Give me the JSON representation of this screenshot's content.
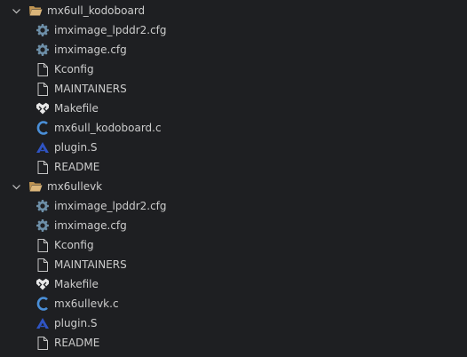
{
  "explorer": {
    "folders": [
      {
        "name": "mx6ull_kodoboard",
        "files": [
          {
            "name": "imximage_lpddr2.cfg",
            "icon": "gear-icon"
          },
          {
            "name": "imximage.cfg",
            "icon": "gear-icon"
          },
          {
            "name": "Kconfig",
            "icon": "file-icon"
          },
          {
            "name": "MAINTAINERS",
            "icon": "file-icon"
          },
          {
            "name": "Makefile",
            "icon": "makefile-icon"
          },
          {
            "name": "mx6ull_kodoboard.c",
            "icon": "c-file-icon"
          },
          {
            "name": "plugin.S",
            "icon": "assembly-icon"
          },
          {
            "name": "README",
            "icon": "file-icon"
          }
        ]
      },
      {
        "name": "mx6ullevk",
        "files": [
          {
            "name": "imximage_lpddr2.cfg",
            "icon": "gear-icon"
          },
          {
            "name": "imximage.cfg",
            "icon": "gear-icon"
          },
          {
            "name": "Kconfig",
            "icon": "file-icon"
          },
          {
            "name": "MAINTAINERS",
            "icon": "file-icon"
          },
          {
            "name": "Makefile",
            "icon": "makefile-icon"
          },
          {
            "name": "mx6ullevk.c",
            "icon": "c-file-icon"
          },
          {
            "name": "plugin.S",
            "icon": "assembly-icon"
          },
          {
            "name": "README",
            "icon": "file-icon"
          }
        ]
      }
    ],
    "colors": {
      "background": "#1e1f22",
      "text": "#cccccc",
      "folder": "#c09553",
      "gear": "#6d8fa8",
      "c_file": "#4a8fd8",
      "assembly": "#2f54c4"
    }
  }
}
